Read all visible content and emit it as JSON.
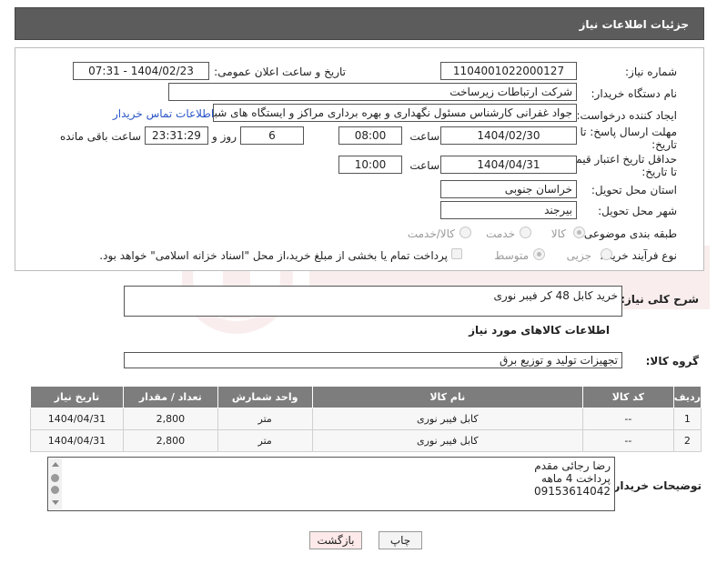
{
  "header": {
    "title": "جزئیات اطلاعات نیاز"
  },
  "form": {
    "need_number_label": "شماره نیاز:",
    "need_number": "1104001022000127",
    "announce_label": "تاریخ و ساعت اعلان عمومی:",
    "announce_value": "1404/02/23 - 07:31",
    "buyer_org_label": "نام دستگاه خریدار:",
    "buyer_org": "شرکت ارتباطات زیرساخت",
    "creator_label": "ایجاد کننده درخواست:",
    "creator": "جواد غفرانی کارشناس مسئول نگهداری و بهره برداری مراکز و ایستگاه های شبکه",
    "contact_link": "اطلاعات تماس خریدار",
    "deadline_label_1": "مهلت ارسال پاسخ: تا",
    "deadline_label_2": "تاریخ:",
    "deadline_date": "1404/02/30",
    "time_label": "ساعت",
    "deadline_time": "08:00",
    "days_value": "6",
    "days_label": "روز و",
    "remaining_time": "23:31:29",
    "remaining_label": "ساعت باقی مانده",
    "validity_label_1": "حداقل تاریخ اعتبار قیمت:",
    "validity_label_2": "تا تاریخ:",
    "validity_date": "1404/04/31",
    "validity_time": "10:00",
    "province_label": "استان محل تحویل:",
    "province": "خراسان جنوبی",
    "city_label": "شهر محل تحویل:",
    "city": "بیرجند",
    "category_label": "طبقه بندی موضوعی:",
    "category_options": [
      "کالا",
      "خدمت",
      "کالا/خدمت"
    ],
    "process_label": "نوع فرآیند خرید :",
    "process_options": [
      "جزیی",
      "متوسط"
    ],
    "payment_note": "پرداخت تمام یا بخشی از مبلغ خرید،از محل \"اسناد خزانه اسلامی\" خواهد بود."
  },
  "summary": {
    "label": "شرح کلی نیاز:",
    "value": "خرید کابل 48 کر فیبر نوری"
  },
  "goods_section_title": "اطلاعات کالاهای مورد نیاز",
  "goods_group": {
    "label": "گروه کالا:",
    "value": "تجهیزات تولید و توزیع برق"
  },
  "table": {
    "headers": [
      "ردیف",
      "کد کالا",
      "نام کالا",
      "واحد شمارش",
      "تعداد / مقدار",
      "تاریخ نیاز"
    ],
    "rows": [
      [
        "1",
        "--",
        "کابل فیبر نوری",
        "متر",
        "2,800",
        "1404/04/31"
      ],
      [
        "2",
        "--",
        "کابل فیبر نوری",
        "متر",
        "2,800",
        "1404/04/31"
      ]
    ]
  },
  "buyer_notes": {
    "label": "توضیحات خریدار:",
    "lines": [
      "رضا رجائی مقدم",
      "پرداخت 4 ماهه",
      "09153614042"
    ]
  },
  "buttons": {
    "print": "چاپ",
    "back": "بازگشت"
  },
  "colors": {
    "header_bg": "#5c5c5c",
    "table_header_bg": "#7d7d7d",
    "link": "#2a55c7",
    "back_button_bg": "#fde9e9"
  }
}
